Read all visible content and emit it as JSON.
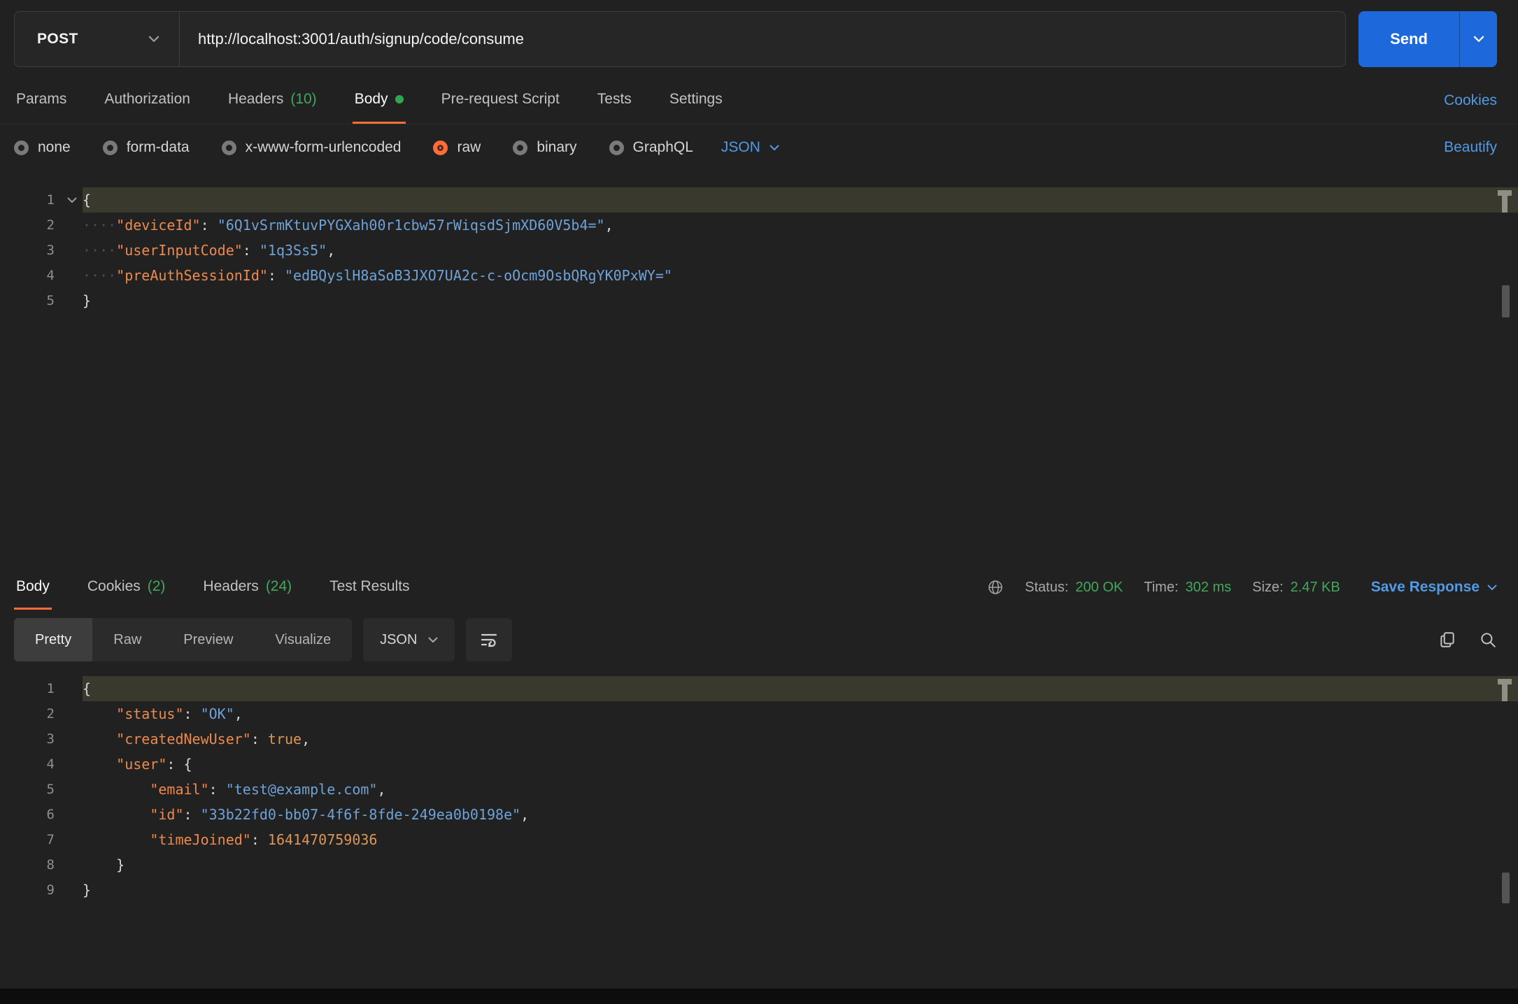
{
  "colors": {
    "accent_orange": "#ff6c37",
    "link_blue": "#519ae5",
    "green": "#42a85c",
    "send_blue": "#1d68da",
    "code_key": "#ec8a4f",
    "code_string": "#6ea2d8",
    "code_number": "#dc9656",
    "code_punctuation": "#d8d8d8"
  },
  "request": {
    "method": "POST",
    "url": "http://localhost:3001/auth/signup/code/consume",
    "send_label": "Send",
    "cookies_label": "Cookies",
    "beautify_label": "Beautify",
    "language": "JSON",
    "tabs": [
      {
        "label": "Params"
      },
      {
        "label": "Authorization"
      },
      {
        "label": "Headers",
        "count": "(10)"
      },
      {
        "label": "Body",
        "active": true,
        "dot": true
      },
      {
        "label": "Pre-request Script"
      },
      {
        "label": "Tests"
      },
      {
        "label": "Settings"
      }
    ],
    "body_types": [
      {
        "label": "none"
      },
      {
        "label": "form-data"
      },
      {
        "label": "x-www-form-urlencoded"
      },
      {
        "label": "raw",
        "selected": true
      },
      {
        "label": "binary"
      },
      {
        "label": "GraphQL"
      }
    ],
    "editor": {
      "highlight_line": 1,
      "fold_caret_line": 1,
      "lines": [
        {
          "n": 1,
          "tokens": [
            {
              "c": "pun",
              "t": "{"
            }
          ]
        },
        {
          "n": 2,
          "tokens": [
            {
              "c": "ind",
              "t": "····"
            },
            {
              "c": "key",
              "t": "\"deviceId\""
            },
            {
              "c": "pun",
              "t": ": "
            },
            {
              "c": "str",
              "t": "\"6Q1vSrmKtuvPYGXah00r1cbw57rWiqsdSjmXD60V5b4=\""
            },
            {
              "c": "pun",
              "t": ","
            }
          ]
        },
        {
          "n": 3,
          "tokens": [
            {
              "c": "ind",
              "t": "····"
            },
            {
              "c": "key",
              "t": "\"userInputCode\""
            },
            {
              "c": "pun",
              "t": ": "
            },
            {
              "c": "str",
              "t": "\"1q3Ss5\""
            },
            {
              "c": "pun",
              "t": ","
            }
          ]
        },
        {
          "n": 4,
          "tokens": [
            {
              "c": "ind",
              "t": "····"
            },
            {
              "c": "key",
              "t": "\"preAuthSessionId\""
            },
            {
              "c": "pun",
              "t": ": "
            },
            {
              "c": "str",
              "t": "\"edBQyslH8aSoB3JXO7UA2c-c-oOcm9OsbQRgYK0PxWY=\""
            }
          ]
        },
        {
          "n": 5,
          "tokens": [
            {
              "c": "pun",
              "t": "}"
            }
          ]
        }
      ]
    }
  },
  "response": {
    "save_label": "Save Response",
    "language": "JSON",
    "tabs": [
      {
        "label": "Body",
        "active": true
      },
      {
        "label": "Cookies",
        "count": "(2)"
      },
      {
        "label": "Headers",
        "count": "(24)"
      },
      {
        "label": "Test Results"
      }
    ],
    "meta": [
      {
        "key": "status",
        "label": "Status:",
        "value": "200 OK"
      },
      {
        "key": "time",
        "label": "Time:",
        "value": "302 ms"
      },
      {
        "key": "size",
        "label": "Size:",
        "value": "2.47 KB"
      }
    ],
    "view_tabs": [
      {
        "label": "Pretty",
        "active": true
      },
      {
        "label": "Raw"
      },
      {
        "label": "Preview"
      },
      {
        "label": "Visualize"
      }
    ],
    "editor": {
      "highlight_line": 1,
      "lines": [
        {
          "n": 1,
          "tokens": [
            {
              "c": "pun",
              "t": "{"
            }
          ]
        },
        {
          "n": 2,
          "tokens": [
            {
              "c": "ws",
              "t": "    "
            },
            {
              "c": "key",
              "t": "\"status\""
            },
            {
              "c": "pun",
              "t": ": "
            },
            {
              "c": "str",
              "t": "\"OK\""
            },
            {
              "c": "pun",
              "t": ","
            }
          ]
        },
        {
          "n": 3,
          "tokens": [
            {
              "c": "ws",
              "t": "    "
            },
            {
              "c": "key",
              "t": "\"createdNewUser\""
            },
            {
              "c": "pun",
              "t": ": "
            },
            {
              "c": "num",
              "t": "true"
            },
            {
              "c": "pun",
              "t": ","
            }
          ]
        },
        {
          "n": 4,
          "tokens": [
            {
              "c": "ws",
              "t": "    "
            },
            {
              "c": "key",
              "t": "\"user\""
            },
            {
              "c": "pun",
              "t": ": {"
            }
          ]
        },
        {
          "n": 5,
          "tokens": [
            {
              "c": "ws",
              "t": "        "
            },
            {
              "c": "key",
              "t": "\"email\""
            },
            {
              "c": "pun",
              "t": ": "
            },
            {
              "c": "str",
              "t": "\"test@example.com\""
            },
            {
              "c": "pun",
              "t": ","
            }
          ]
        },
        {
          "n": 6,
          "tokens": [
            {
              "c": "ws",
              "t": "        "
            },
            {
              "c": "key",
              "t": "\"id\""
            },
            {
              "c": "pun",
              "t": ": "
            },
            {
              "c": "str",
              "t": "\"33b22fd0-bb07-4f6f-8fde-249ea0b0198e\""
            },
            {
              "c": "pun",
              "t": ","
            }
          ]
        },
        {
          "n": 7,
          "tokens": [
            {
              "c": "ws",
              "t": "        "
            },
            {
              "c": "key",
              "t": "\"timeJoined\""
            },
            {
              "c": "pun",
              "t": ": "
            },
            {
              "c": "num",
              "t": "1641470759036"
            }
          ]
        },
        {
          "n": 8,
          "tokens": [
            {
              "c": "ws",
              "t": "    "
            },
            {
              "c": "pun",
              "t": "}"
            }
          ]
        },
        {
          "n": 9,
          "tokens": [
            {
              "c": "pun",
              "t": "}"
            }
          ]
        }
      ]
    }
  }
}
